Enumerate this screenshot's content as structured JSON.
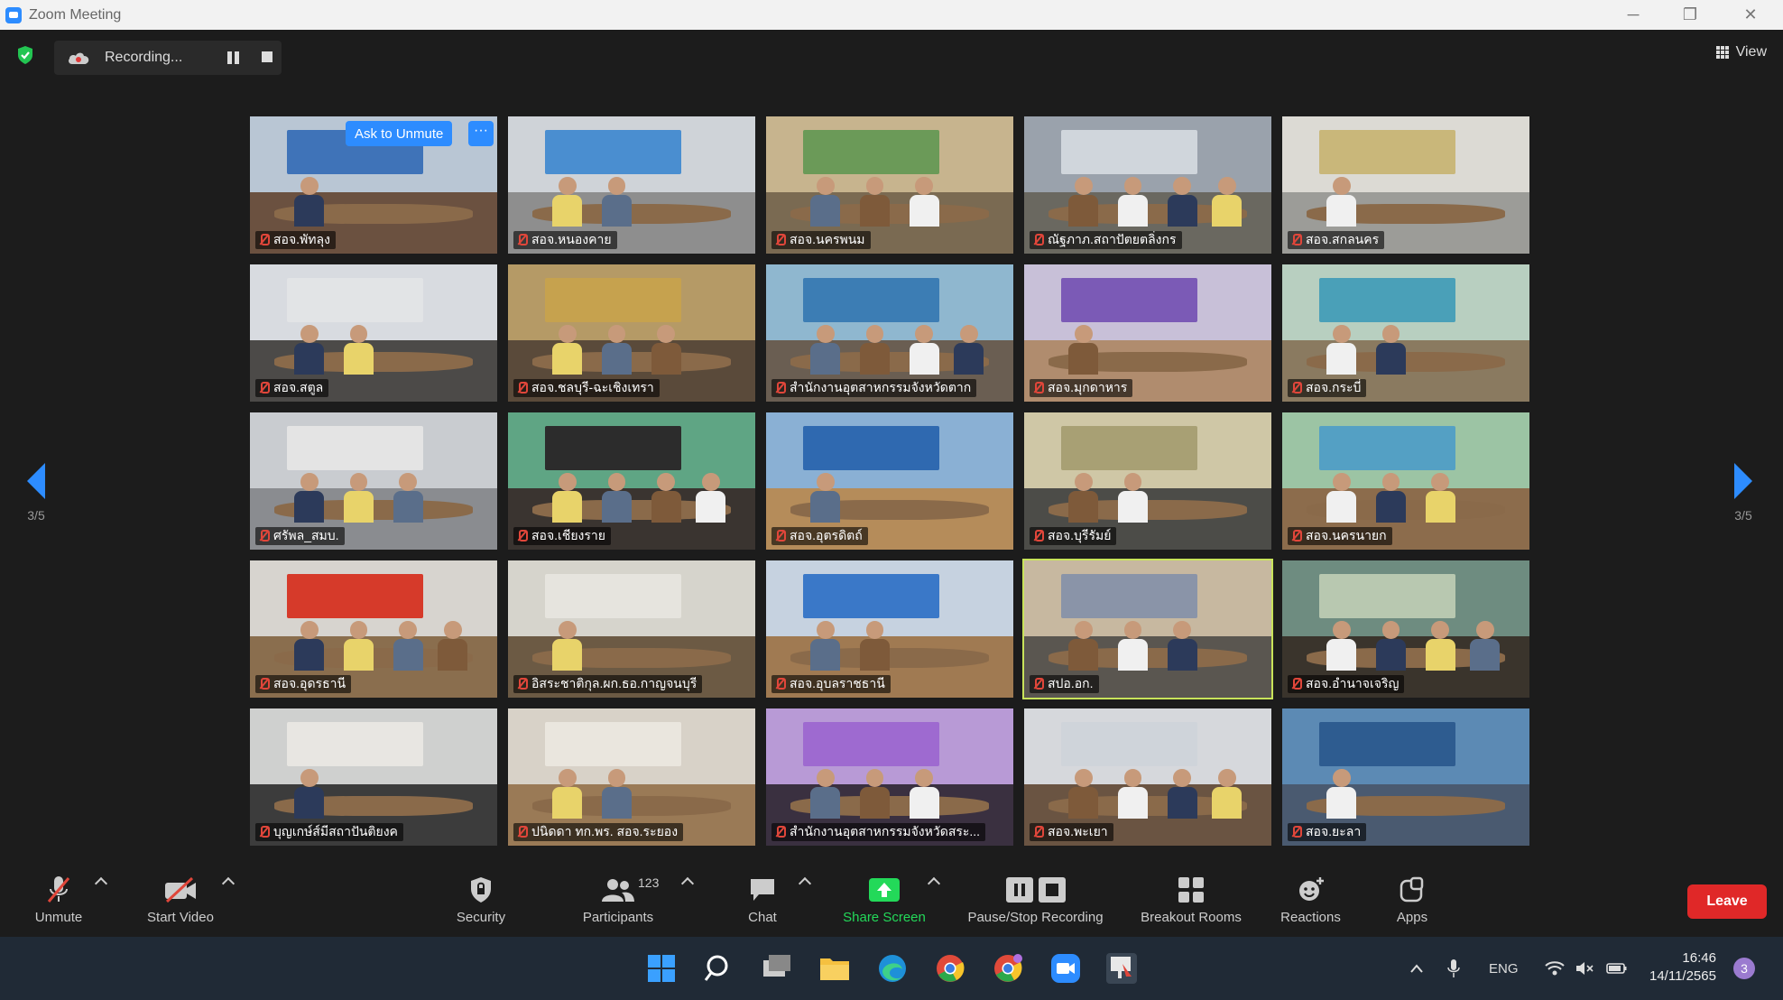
{
  "window": {
    "title": "Zoom Meeting",
    "minimize": "─",
    "restore": "❐",
    "close": "✕"
  },
  "topbar": {
    "recording_label": "Recording...",
    "view_label": "View"
  },
  "pagination": {
    "left_page": "3/5",
    "right_page": "3/5"
  },
  "gallery": {
    "ask_to_unmute": "Ask to Unmute",
    "more": "···",
    "tiles": [
      {
        "name": "สอจ.พัทลุง",
        "wall": "#b9c6d4",
        "floor": "#6b5140",
        "banner": "#3f73b8",
        "active": false
      },
      {
        "name": "สอจ.หนองคาย",
        "wall": "#cfd3d8",
        "floor": "#8e8e8e",
        "banner": "#4a8ed0",
        "active": false
      },
      {
        "name": "สอจ.นครพนม",
        "wall": "#c7b48e",
        "floor": "#7a6a52",
        "banner": "#6b9a58",
        "active": false
      },
      {
        "name": "ณัฐภาภ.สถาปัตยตลิ่งกร",
        "wall": "#9aa2ac",
        "floor": "#6a6860",
        "banner": "#d0d6dc",
        "active": false
      },
      {
        "name": "สอจ.สกลนคร",
        "wall": "#dcdad4",
        "floor": "#9c9c98",
        "banner": "#c9b77a",
        "active": false
      },
      {
        "name": "สอจ.สตูล",
        "wall": "#d8dbe0",
        "floor": "#4c4a48",
        "banner": "#e2e4e6",
        "active": false
      },
      {
        "name": "สอจ.ชลบุรี-ฉะเชิงเทรา",
        "wall": "#b59a66",
        "floor": "#5a4a3a",
        "banner": "#c6a24e",
        "active": false
      },
      {
        "name": "สำนักงานอุตสาหกรรมจังหวัดตาก",
        "wall": "#8fb7cf",
        "floor": "#6a5e52",
        "banner": "#3c7db4",
        "active": false
      },
      {
        "name": "สอจ.มุกดาหาร",
        "wall": "#c8c0d8",
        "floor": "#b08c6e",
        "banner": "#7b5ab6",
        "active": false
      },
      {
        "name": "สอจ.กระบี่",
        "wall": "#b8cfc0",
        "floor": "#8a7a60",
        "banner": "#4aa0b8",
        "active": false
      },
      {
        "name": "ศรัพล_สมบ.",
        "wall": "#c9ccd0",
        "floor": "#8a8c90",
        "banner": "#e4e4e4",
        "active": false
      },
      {
        "name": "สอจ.เชียงราย",
        "wall": "#5fa584",
        "floor": "#3a3430",
        "banner": "#2c2c2c",
        "active": false
      },
      {
        "name": "สอจ.อุตรดิตถ์",
        "wall": "#8ab0d4",
        "floor": "#b58c5a",
        "banner": "#2f69b0",
        "active": false
      },
      {
        "name": "สอจ.บุรีรัมย์",
        "wall": "#cfc7a6",
        "floor": "#4c4c48",
        "banner": "#a8a074",
        "active": false
      },
      {
        "name": "สอจ.นครนายก",
        "wall": "#9cc4a4",
        "floor": "#8c6c4c",
        "banner": "#54a0c4",
        "active": false
      },
      {
        "name": "สอจ.อุดรธานี",
        "wall": "#d7d4cf",
        "floor": "#8a6e4e",
        "banner": "#d63a2a",
        "active": false
      },
      {
        "name": "อิสระชาติกุล.ผก.ธอ.กาญจนบุรี",
        "wall": "#d6d4cc",
        "floor": "#6c5a44",
        "banner": "#e6e4de",
        "active": false
      },
      {
        "name": "สอจ.อุบลราชธานี",
        "wall": "#c6d2e0",
        "floor": "#a07a52",
        "banner": "#3a78c8",
        "active": false
      },
      {
        "name": "สปอ.อก.",
        "wall": "#c7b8a0",
        "floor": "#5a5650",
        "banner": "#8a94a8",
        "active": true
      },
      {
        "name": "สอจ.อำนาจเจริญ",
        "wall": "#6e8c80",
        "floor": "#3a342c",
        "banner": "#b8c8b0",
        "active": false
      },
      {
        "name": "บุญเกษ์ส์มีสถาปันติยงค",
        "wall": "#cfd0cf",
        "floor": "#3c3c3c",
        "banner": "#e8e6e2",
        "active": false
      },
      {
        "name": "ปนิดดา ทก.พร. สอจ.ระยอง",
        "wall": "#d8d2c8",
        "floor": "#9a7a56",
        "banner": "#eae6de",
        "active": false
      },
      {
        "name": "สำนักงานอุตสาหกรรมจังหวัดสระ...",
        "wall": "#b89ad6",
        "floor": "#3a3040",
        "banner": "#9e6ad0",
        "active": false
      },
      {
        "name": "สอจ.พะเยา",
        "wall": "#d6d8dc",
        "floor": "#6a5442",
        "banner": "#cfd4da",
        "active": false
      },
      {
        "name": "สอจ.ยะลา",
        "wall": "#5c8ab4",
        "floor": "#4a5a70",
        "banner": "#2e5c90",
        "active": false
      }
    ]
  },
  "toolbar": {
    "unmute": "Unmute",
    "start_video": "Start Video",
    "security": "Security",
    "participants": "Participants",
    "participants_count": "123",
    "chat": "Chat",
    "share_screen": "Share Screen",
    "pause_stop_recording": "Pause/Stop Recording",
    "breakout_rooms": "Breakout Rooms",
    "reactions": "Reactions",
    "apps": "Apps",
    "leave": "Leave"
  },
  "taskbar": {
    "language": "ENG",
    "time": "16:46",
    "date": "14/11/2565",
    "notification_count": "3"
  },
  "colors": {
    "accent_blue": "#2d8cff",
    "leave_red": "#e02828",
    "share_green": "#23d959",
    "active_speaker": "#c8e35a"
  }
}
